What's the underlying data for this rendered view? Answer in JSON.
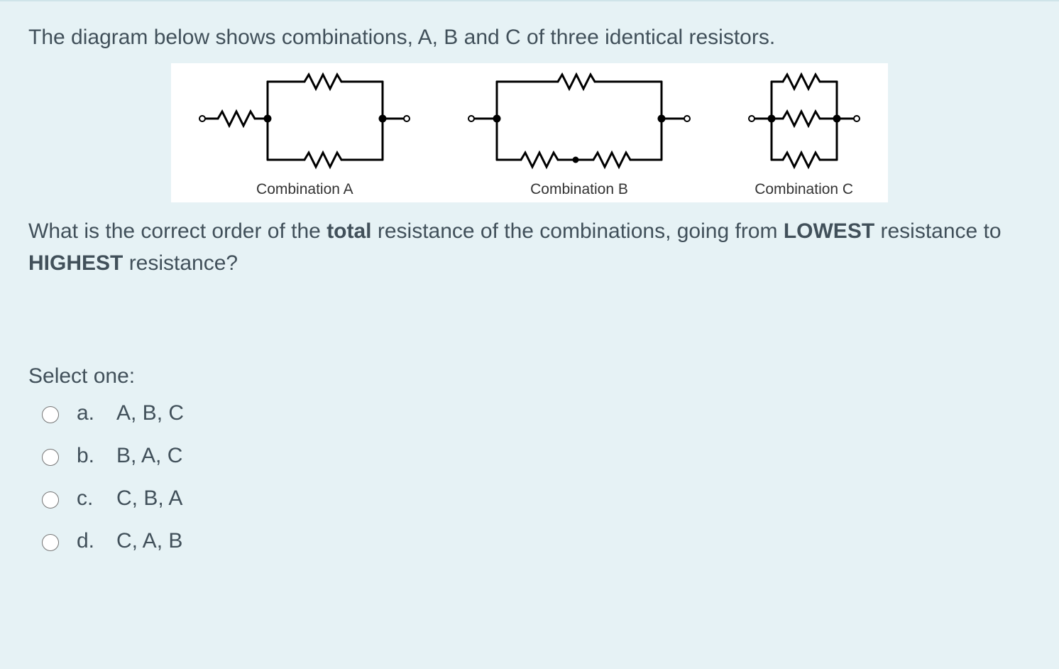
{
  "question": {
    "intro": "The diagram below shows combinations, A, B and C of three identical resistors.",
    "prompt_pre": "What is the correct order of the ",
    "prompt_bold1": "total",
    "prompt_mid": " resistance of the combinations, going from ",
    "prompt_bold2": "LOWEST",
    "prompt_mid2": " resistance to ",
    "prompt_bold3": "HIGHEST",
    "prompt_end": " resistance?"
  },
  "diagram": {
    "captions": {
      "a": "Combination A",
      "b": "Combination B",
      "c": "Combination C"
    },
    "descriptions": {
      "a": "One resistor in series with two resistors in parallel",
      "b": "One resistor in parallel with two series resistors",
      "c": "Three resistors all in parallel"
    }
  },
  "answers": {
    "select_label": "Select one:",
    "options": [
      {
        "letter": "a.",
        "text": "A, B, C"
      },
      {
        "letter": "b.",
        "text": "B, A, C"
      },
      {
        "letter": "c.",
        "text": "C, B, A"
      },
      {
        "letter": "d.",
        "text": "C, A, B"
      }
    ]
  }
}
